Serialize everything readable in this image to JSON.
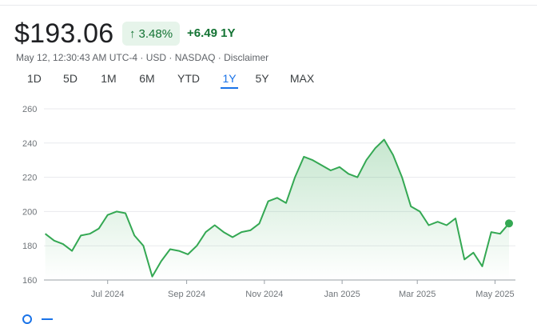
{
  "quote": {
    "price": "$193.06",
    "change_pct": "3.48%",
    "change_abs": "+6.49",
    "change_period": "1Y",
    "timestamp": "May 12, 12:30:43 AM UTC-4",
    "currency": "USD",
    "exchange": "NASDAQ",
    "disclaimer": "Disclaimer",
    "separator": " · "
  },
  "ranges": [
    {
      "label": "1D"
    },
    {
      "label": "5D"
    },
    {
      "label": "1M"
    },
    {
      "label": "6M"
    },
    {
      "label": "YTD"
    },
    {
      "label": "1Y",
      "active": true
    },
    {
      "label": "5Y"
    },
    {
      "label": "MAX"
    }
  ],
  "colors": {
    "line": "#34a853",
    "positive": "#137333",
    "active_tab": "#1a73e8"
  },
  "chart_data": {
    "type": "area",
    "title": "",
    "xlabel": "",
    "ylabel": "",
    "ylim": [
      160,
      260
    ],
    "y_ticks": [
      160,
      180,
      200,
      220,
      240,
      260
    ],
    "x_tick_labels": [
      "Jul 2024",
      "Sep 2024",
      "Nov 2024",
      "Jan 2025",
      "Mar 2025",
      "May 2025"
    ],
    "grid": "horizontal",
    "x": [
      "2024-05-13",
      "2024-05-20",
      "2024-05-27",
      "2024-06-03",
      "2024-06-10",
      "2024-06-17",
      "2024-06-24",
      "2024-07-01",
      "2024-07-08",
      "2024-07-15",
      "2024-07-22",
      "2024-07-29",
      "2024-08-05",
      "2024-08-12",
      "2024-08-19",
      "2024-08-26",
      "2024-09-02",
      "2024-09-09",
      "2024-09-16",
      "2024-09-23",
      "2024-09-30",
      "2024-10-07",
      "2024-10-14",
      "2024-10-21",
      "2024-10-28",
      "2024-11-04",
      "2024-11-11",
      "2024-11-18",
      "2024-11-25",
      "2024-12-02",
      "2024-12-09",
      "2024-12-16",
      "2024-12-23",
      "2024-12-30",
      "2025-01-06",
      "2025-01-13",
      "2025-01-20",
      "2025-01-27",
      "2025-02-03",
      "2025-02-10",
      "2025-02-17",
      "2025-02-24",
      "2025-03-03",
      "2025-03-10",
      "2025-03-17",
      "2025-03-24",
      "2025-03-31",
      "2025-04-07",
      "2025-04-14",
      "2025-04-21",
      "2025-04-28",
      "2025-05-05",
      "2025-05-12"
    ],
    "series": [
      {
        "values": [
          187,
          183,
          181,
          177,
          186,
          187,
          190,
          198,
          200,
          199,
          186,
          180,
          162,
          171,
          178,
          177,
          175,
          180,
          188,
          192,
          188,
          185,
          188,
          189,
          193,
          206,
          208,
          205,
          220,
          232,
          230,
          227,
          224,
          226,
          222,
          220,
          230,
          237,
          242,
          233,
          220,
          203,
          200,
          192,
          194,
          192,
          196,
          172,
          176,
          168,
          188,
          187,
          193.06
        ]
      }
    ],
    "last_value": 193.06
  }
}
